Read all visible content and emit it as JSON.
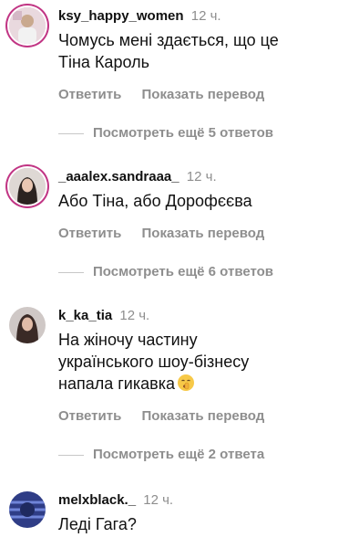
{
  "comments": [
    {
      "username": "ksy_happy_women",
      "time": "12 ч.",
      "text_lines": [
        "Чомусь мені здається, що це",
        "Тіна Кароль"
      ],
      "reply_label": "Ответить",
      "translate_label": "Показать перевод",
      "more_replies": "Посмотреть ещё 5 ответов"
    },
    {
      "username": "_aaalex.sandraaa_",
      "time": "12 ч.",
      "text_lines": [
        "Або Тіна, або Дорофєєва"
      ],
      "reply_label": "Ответить",
      "translate_label": "Показать перевод",
      "more_replies": "Посмотреть ещё 6 ответов"
    },
    {
      "username": "k_ka_tia",
      "time": "12 ч.",
      "text_lines": [
        "На жіночу частину",
        "українського шоу-бізнесу",
        "напала гикавка"
      ],
      "reply_label": "Ответить",
      "translate_label": "Показать перевод",
      "more_replies": "Посмотреть ещё 2 ответа"
    },
    {
      "username": "melxblack._",
      "time": "12 ч.",
      "text_lines": [
        "Леді Гага?"
      ]
    }
  ],
  "icons": {
    "emoji": "shushing-face-emoji-icon"
  }
}
